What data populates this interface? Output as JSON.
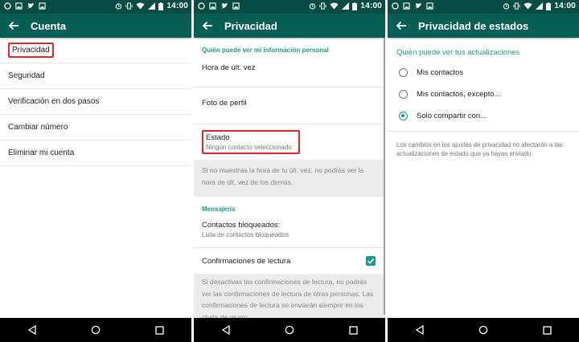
{
  "status": {
    "time": "14:00"
  },
  "screen1": {
    "title": "Cuenta",
    "items": [
      "Privacidad",
      "Seguridad",
      "Verificación en dos pasos",
      "Cambiar número",
      "Eliminar mi cuenta"
    ]
  },
  "screen2": {
    "title": "Privacidad",
    "section_personal": "Quién puede ver mi información personal",
    "last_seen": "Hora de últ. vez",
    "profile_photo": "Foto de perfil",
    "status_title": "Estado",
    "status_sub": "Ningún contacto seleccionado",
    "note1": "Si no muestras la hora de tu últ. vez, no podrás ver la hora de últ. vez de los demás.",
    "section_messaging": "Mensajería",
    "blocked_title": "Contactos bloqueados:",
    "blocked_sub": "Lista de contactos bloqueados",
    "read_receipts": "Confirmaciones de lectura",
    "read_receipts_checked": true,
    "note2": "Si desactivas las confirmaciones de lectura, no podrás ver las confirmaciones de lectura de otras personas. Las confirmaciones de lectura se enviarán siempre en los chats de grupo."
  },
  "screen3": {
    "title": "Privacidad de estados",
    "section": "Quién puede ver tus actualizaciones",
    "options": [
      "Mis contactos",
      "Mis contactos, excepto...",
      "Solo compartir con..."
    ],
    "selected_index": 2,
    "note": "Los cambios en los ajustes de privacidad no afectarán a las actualizaciones de estado que ya hayas enviado"
  },
  "colors": {
    "appbar": "#075e54",
    "statusbar": "#054d44",
    "accent": "#1e9987",
    "highlight": "#e0262b"
  },
  "icons": [
    "whatsapp-icon",
    "image-icon",
    "twitter-icon",
    "alarm-icon",
    "vibrate-icon",
    "wifi-icon",
    "signal-icon",
    "battery-icon",
    "back-arrow-icon",
    "nav-back-icon",
    "nav-home-icon",
    "nav-recents-icon"
  ]
}
